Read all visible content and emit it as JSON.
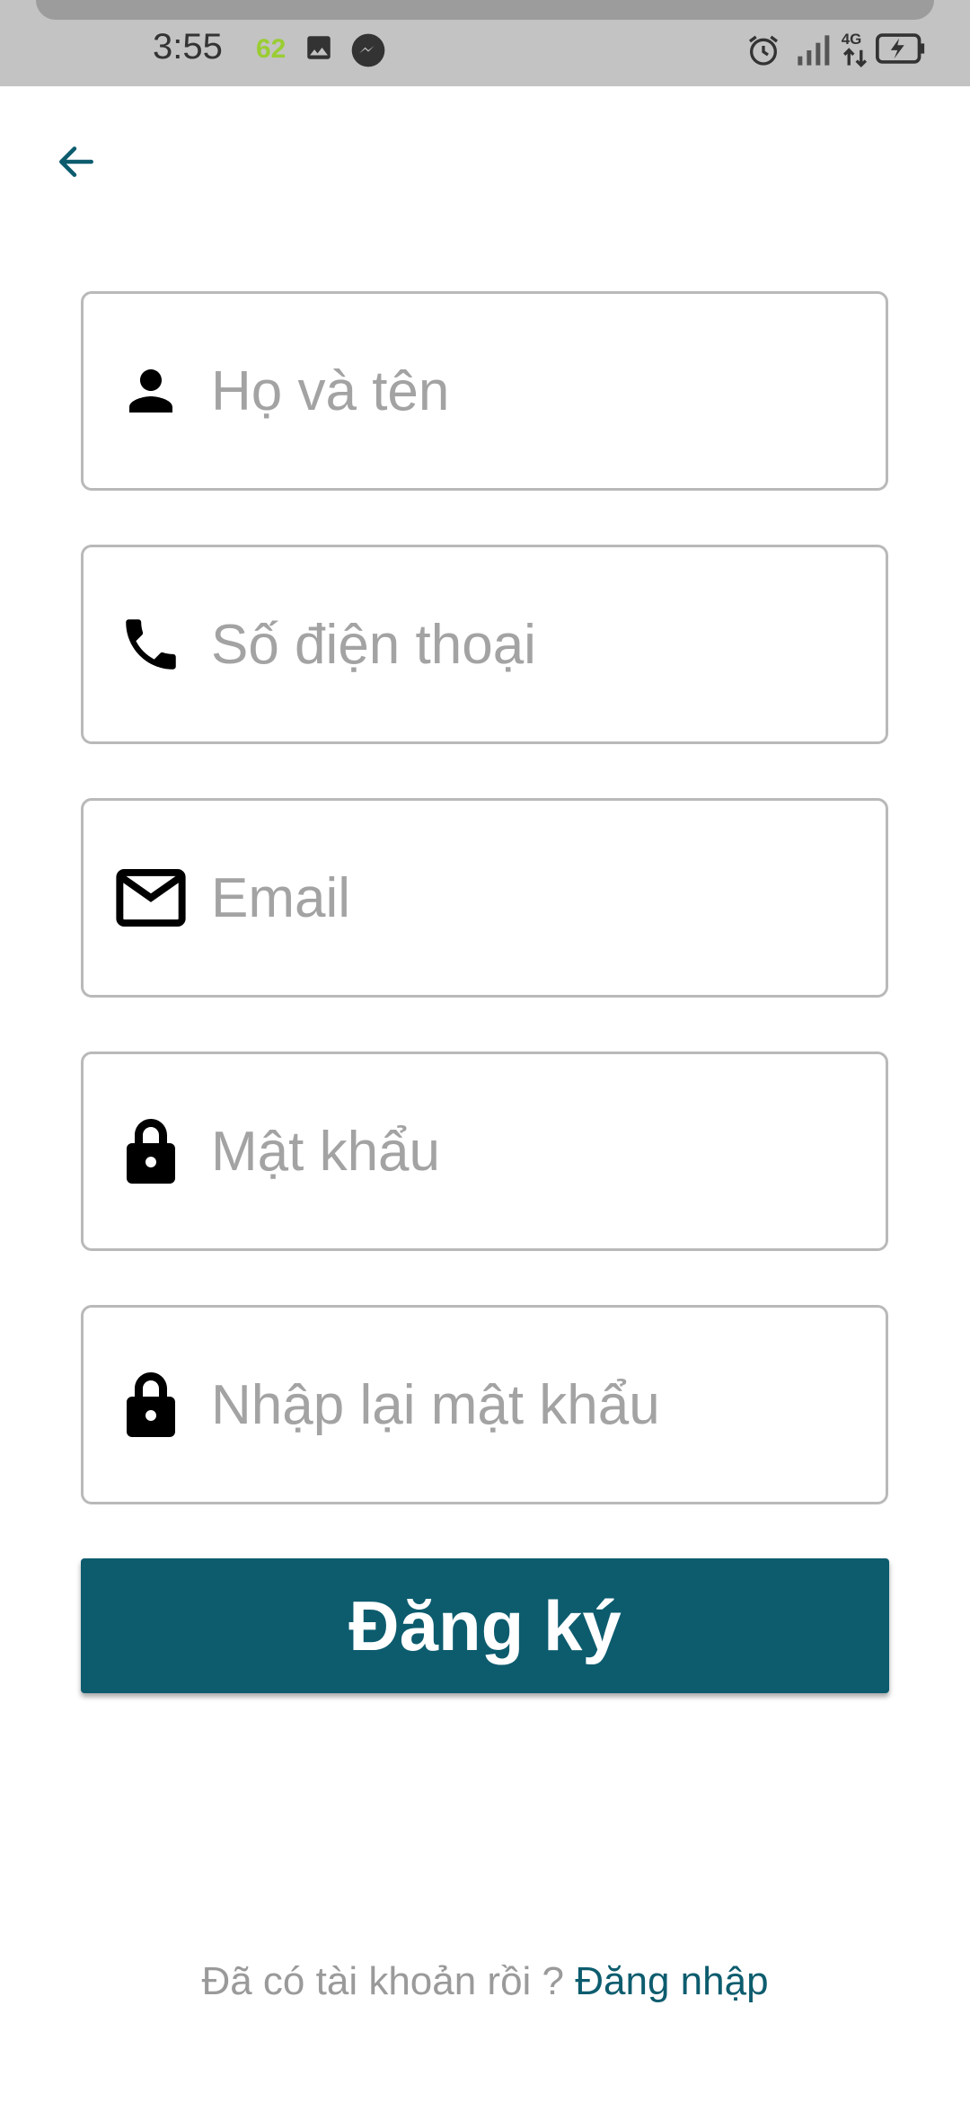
{
  "status_bar": {
    "time": "3:55",
    "badge": "62",
    "icons": [
      "image-icon",
      "messenger-icon",
      "alarm-icon",
      "signal-icon",
      "network-4g-icon",
      "battery-charging-icon"
    ]
  },
  "header": {
    "back_icon": "arrow-left-icon",
    "accent_color": "#0c5c6e"
  },
  "form": {
    "fields": [
      {
        "icon": "person-icon",
        "placeholder": "Họ và tên",
        "value": ""
      },
      {
        "icon": "phone-icon",
        "placeholder": "Số điện thoại",
        "value": ""
      },
      {
        "icon": "mail-icon",
        "placeholder": "Email",
        "value": ""
      },
      {
        "icon": "lock-icon",
        "placeholder": "Mật khẩu",
        "value": ""
      },
      {
        "icon": "lock-icon",
        "placeholder": "Nhập lại mật khẩu",
        "value": ""
      }
    ],
    "submit_label": "Đăng ký"
  },
  "footer": {
    "question": "Đã có tài khoản rồi ?",
    "login_link": "Đăng nhập"
  }
}
